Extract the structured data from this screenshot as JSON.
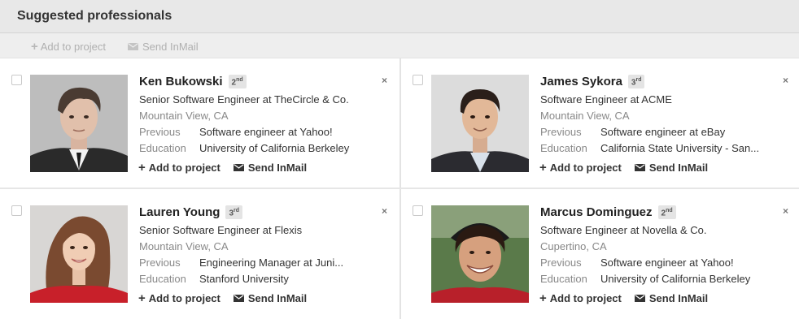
{
  "header": {
    "title": "Suggested professionals"
  },
  "toolbar": {
    "add_label": "Add to project",
    "inmail_label": "Send InMail"
  },
  "labels": {
    "previous": "Previous",
    "education": "Education",
    "add": "Add to project",
    "inmail": "Send InMail",
    "close": "×"
  },
  "cards": [
    {
      "name": "Ken Bukowski",
      "degree": "2",
      "degree_suffix": "nd",
      "headline": "Senior Software Engineer at TheCircle & Co.",
      "location": "Mountain View, CA",
      "previous": "Software engineer at Yahoo!",
      "education": "University of California Berkeley"
    },
    {
      "name": "James Sykora",
      "degree": "3",
      "degree_suffix": "rd",
      "headline": "Software Engineer at ACME",
      "location": "Mountain View, CA",
      "previous": "Software engineer at eBay",
      "education": "California State University - San..."
    },
    {
      "name": "Lauren Young",
      "degree": "3",
      "degree_suffix": "rd",
      "headline": "Senior Software Engineer at Flexis",
      "location": "Mountain View, CA",
      "previous": "Engineering Manager at Juni...",
      "education": "Stanford University"
    },
    {
      "name": "Marcus Dominguez",
      "degree": "2",
      "degree_suffix": "nd",
      "headline": "Software Engineer at Novella & Co.",
      "location": "Cupertino, CA",
      "previous": "Software engineer at Yahoo!",
      "education": "University of California Berkeley"
    }
  ],
  "colors": {
    "header_bg": "#e8e8e8",
    "toolbar_bg": "#eeeeee",
    "muted_text": "#888888",
    "badge_bg": "#e4e4e4"
  }
}
